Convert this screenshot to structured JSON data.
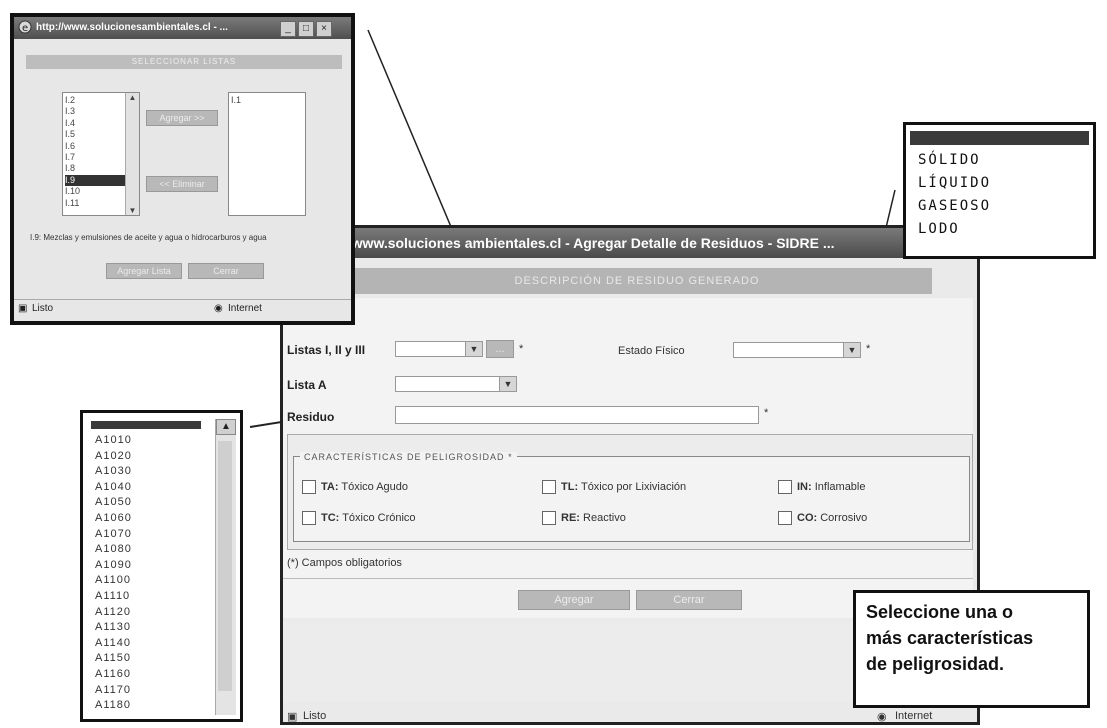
{
  "main_window": {
    "title": "// www.soluciones ambientales.cl - Agregar Detalle de Residuos - SIDRE ...",
    "header": "DESCRIPCIÓN DE RESIDUO GENERADO",
    "listas_label": "Listas I, II y III",
    "estado_label": "Estado Físico",
    "lista_a_label": "Lista A",
    "residuo_label": "Residuo",
    "required_mark": "*",
    "caracteristicas_legend": "CARACTERÍSTICAS DE PELIGROSIDAD",
    "characteristics": [
      {
        "code": "TA:",
        "label": "Tóxico Agudo"
      },
      {
        "code": "TL:",
        "label": "Tóxico por Lixiviación"
      },
      {
        "code": "IN:",
        "label": "Inflamable"
      },
      {
        "code": "TC:",
        "label": "Tóxico Crónico"
      },
      {
        "code": "RE:",
        "label": "Reactivo"
      },
      {
        "code": "CO:",
        "label": "Corrosivo"
      }
    ],
    "required_note": "(*) Campos obligatorios",
    "agregar_button": "Agregar",
    "cerrar_button": "Cerrar",
    "status_left": "Listo",
    "status_right": "Internet",
    "add_button": "..."
  },
  "popup": {
    "title": "http://www.solucionesambientales.cl - ...",
    "header": "SELECCIONAR LISTAS",
    "left_list": [
      "I.2",
      "I.3",
      "I.4",
      "I.5",
      "I.6",
      "I.7",
      "I.8",
      "I.9",
      "I.10",
      "I.11"
    ],
    "selected_item": "I.9",
    "right_list": [
      "I.1"
    ],
    "agregar_button": "Agregar >>",
    "eliminar_button": "<< Eliminar",
    "description": "I.9: Mezclas y emulsiones de aceite y agua o hidrocarburos y agua",
    "aceptar_button": "Agregar Lista",
    "cerrar_button": "Cerrar",
    "status_left": "Listo",
    "status_right": "Internet"
  },
  "estado_dropdown": {
    "options": [
      "SÓLIDO",
      "LÍQUIDO",
      "GASEOSO",
      "LODO"
    ]
  },
  "lista_a_dropdown": {
    "options": [
      "A1010",
      "A1020",
      "A1030",
      "A1040",
      "A1050",
      "A1060",
      "A1070",
      "A1080",
      "A1090",
      "A1100",
      "A1110",
      "A1120",
      "A1130",
      "A1140",
      "A1150",
      "A1160",
      "A1170",
      "A1180"
    ]
  },
  "callout": {
    "line1": "Seleccione una o",
    "line2": "más características",
    "line3": "de peligrosidad."
  }
}
